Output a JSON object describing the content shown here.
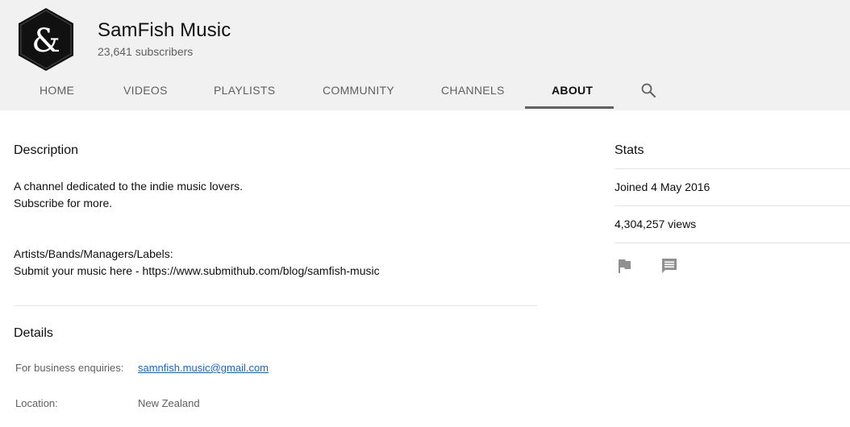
{
  "channel": {
    "name": "SamFish Music",
    "subscribers": "23,641 subscribers",
    "avatar_icon": "ampersand-logo"
  },
  "tabs": [
    {
      "label": "HOME"
    },
    {
      "label": "VIDEOS"
    },
    {
      "label": "PLAYLISTS"
    },
    {
      "label": "COMMUNITY"
    },
    {
      "label": "CHANNELS"
    },
    {
      "label": "ABOUT",
      "active": true
    }
  ],
  "search_icon": "search-icon",
  "description": {
    "title": "Description",
    "line1": "A channel dedicated to the indie music lovers.",
    "line2": "Subscribe for more.",
    "line3": "Artists/Bands/Managers/Labels:",
    "line4": "Submit your music here - https://www.submithub.com/blog/samfish-music"
  },
  "details": {
    "title": "Details",
    "business_label": "For business enquiries:",
    "business_email": "samnfish.music@gmail.com",
    "location_label": "Location:",
    "location_value": "New Zealand"
  },
  "stats": {
    "title": "Stats",
    "joined": "Joined 4 May 2016",
    "views": "4,304,257 views"
  },
  "actions": {
    "flag_icon": "flag-icon",
    "message_icon": "message-icon"
  },
  "colors": {
    "header_bg": "#f1f1f1",
    "link": "#1a66cc",
    "secondary_text": "#606060"
  }
}
